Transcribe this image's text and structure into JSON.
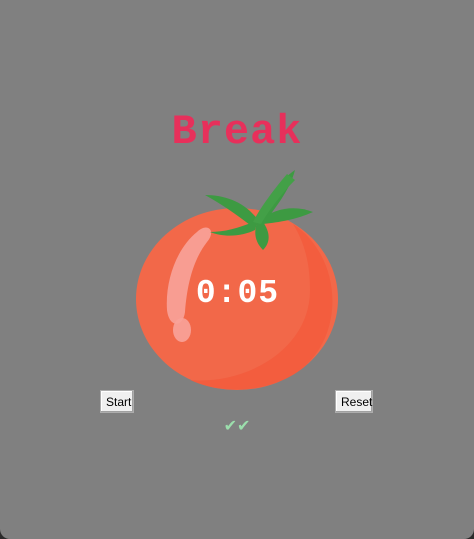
{
  "window": {
    "background": "#808080"
  },
  "header": {
    "title": "Break",
    "title_color": "#e7305b"
  },
  "timer": {
    "display": "0:05",
    "icon": "tomato-icon"
  },
  "controls": {
    "start_label": "Start",
    "reset_label": "Reset"
  },
  "progress": {
    "checkmarks": "✔✔",
    "checkmark_color": "#9bdeac"
  }
}
